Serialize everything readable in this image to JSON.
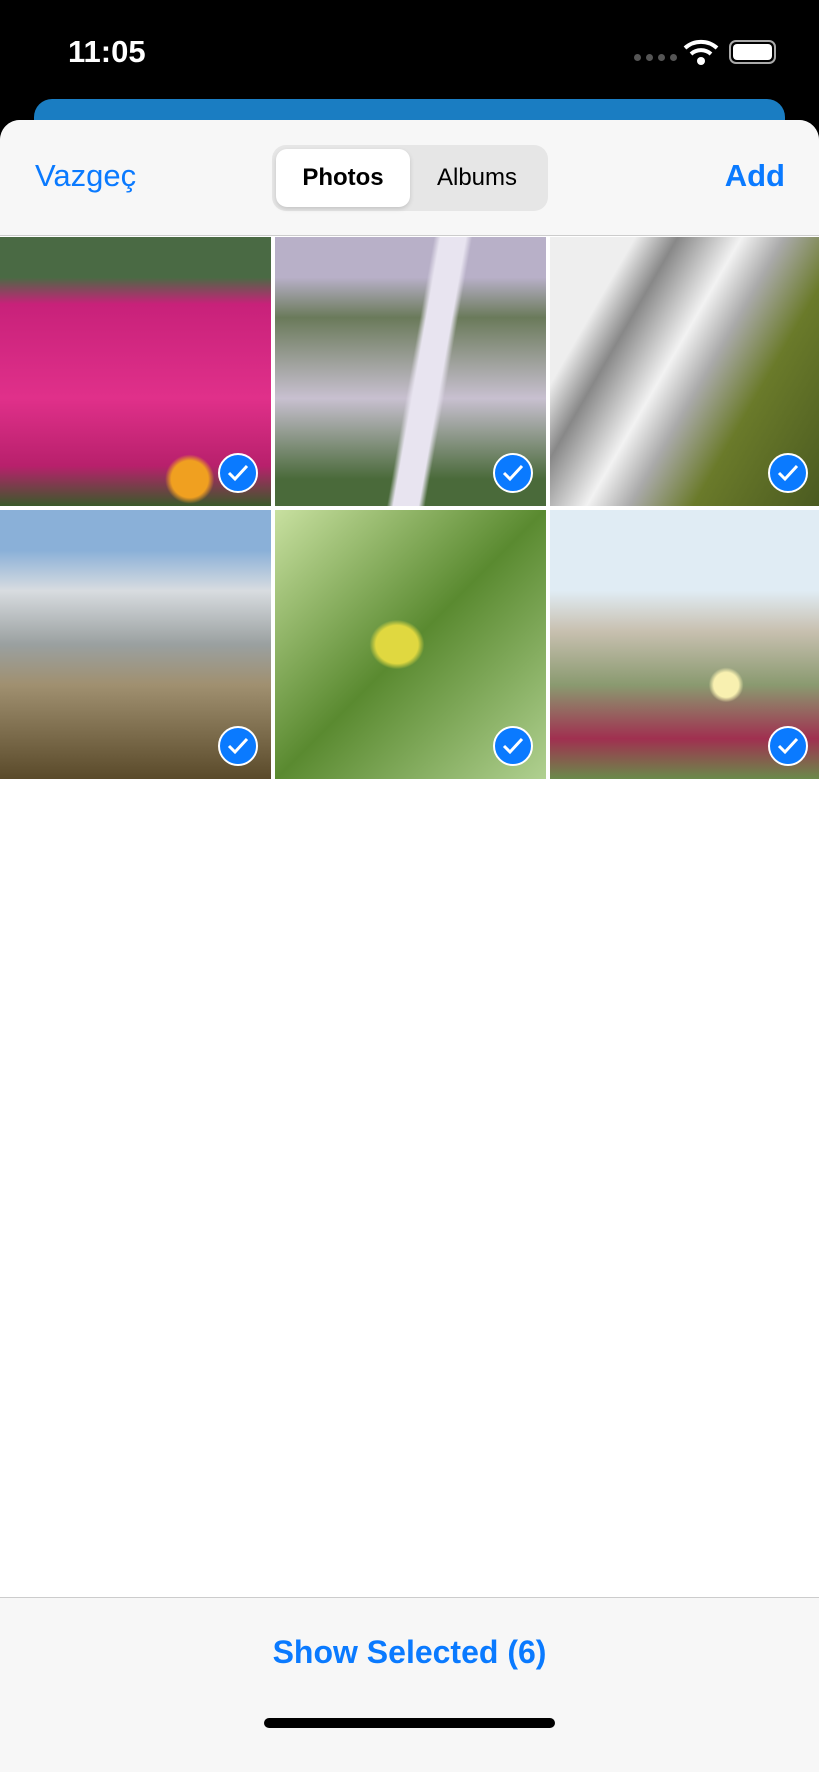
{
  "status_bar": {
    "time": "11:05"
  },
  "nav": {
    "cancel_label": "Vazgeç",
    "add_label": "Add",
    "tabs": [
      {
        "label": "Photos",
        "selected": true
      },
      {
        "label": "Albums",
        "selected": false
      }
    ]
  },
  "photos": [
    {
      "subject": "flowers",
      "selected": true
    },
    {
      "subject": "waterfall",
      "selected": true
    },
    {
      "subject": "waterfall-rocks",
      "selected": true
    },
    {
      "subject": "waterfall-cliff",
      "selected": true
    },
    {
      "subject": "leaves",
      "selected": true
    },
    {
      "subject": "beach-flower",
      "selected": true
    }
  ],
  "footer": {
    "show_selected_label": "Show Selected (6)"
  },
  "colors": {
    "accent": "#0a7aff",
    "card": "#1a7dc2"
  }
}
